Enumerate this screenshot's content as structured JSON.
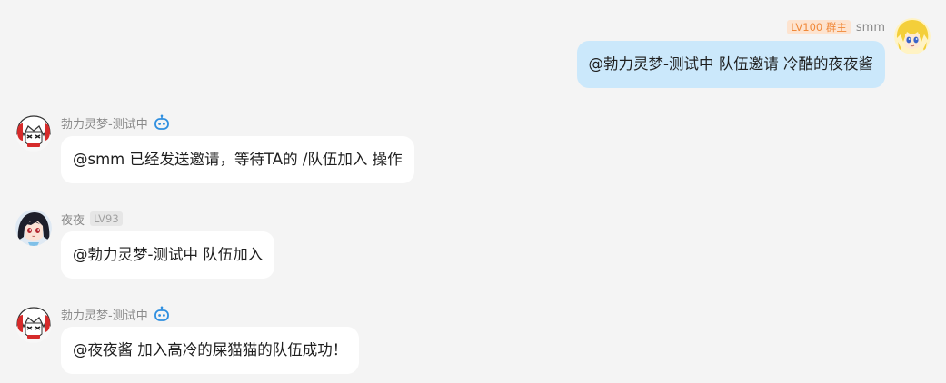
{
  "colors": {
    "background": "#f4f4f4",
    "incoming_bubble": "#ffffff",
    "outgoing_bubble": "#cbe8fb",
    "owner_badge_bg": "#fde3cf",
    "owner_badge_text": "#f0893a",
    "level_badge_bg": "#e6e6e6",
    "bot_icon": "#2f8fe0"
  },
  "messages": [
    {
      "direction": "outgoing",
      "sender": "smm",
      "badge": "LV100 群主",
      "avatar_icon": "blonde-girl-avatar",
      "text": "@勃力灵梦-测试中 队伍邀请 冷酷的夜夜酱"
    },
    {
      "direction": "incoming",
      "sender": "勃力灵梦-测试中",
      "sender_icon": "bot-icon",
      "avatar_icon": "white-hair-bot-avatar",
      "text": "@smm 已经发送邀请，等待TA的 /队伍加入 操作"
    },
    {
      "direction": "incoming",
      "sender": "夜夜",
      "badge": "LV93",
      "avatar_icon": "dark-hair-girl-avatar",
      "text": "@勃力灵梦-测试中 队伍加入"
    },
    {
      "direction": "incoming",
      "sender": "勃力灵梦-测试中",
      "sender_icon": "bot-icon",
      "avatar_icon": "white-hair-bot-avatar",
      "text": "@夜夜酱 加入高冷的屎猫猫的队伍成功！"
    }
  ]
}
